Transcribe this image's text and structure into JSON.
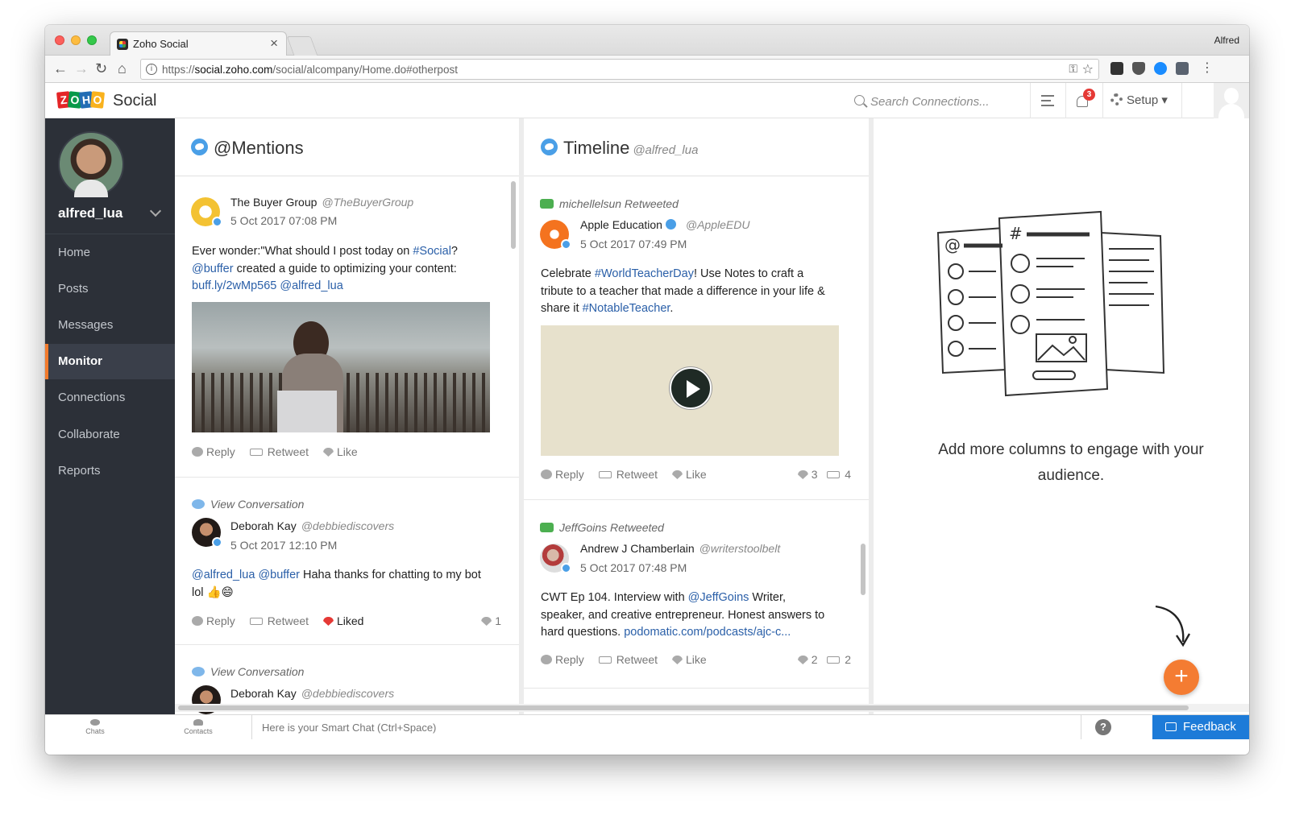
{
  "browser": {
    "tab_title": "Zoho Social",
    "profile": "Alfred",
    "url_scheme": "https://",
    "url_host": "social.zoho.com",
    "url_path": "/social/alcompany/Home.do#otherpost"
  },
  "header": {
    "logo_letters": [
      "Z",
      "O",
      "H",
      "O"
    ],
    "logo_text": "Social",
    "search_placeholder": "Search Connections...",
    "notification_count": "3",
    "setup_label": "Setup"
  },
  "sidebar": {
    "username": "alfred_lua",
    "items": [
      {
        "label": "Home",
        "active": false
      },
      {
        "label": "Posts",
        "active": false
      },
      {
        "label": "Messages",
        "active": false
      },
      {
        "label": "Monitor",
        "active": true
      },
      {
        "label": "Connections",
        "active": false
      },
      {
        "label": "Collaborate",
        "active": false
      },
      {
        "label": "Reports",
        "active": false
      }
    ]
  },
  "mentions": {
    "title": "@Mentions",
    "posts": [
      {
        "author": "The Buyer Group",
        "handle": "@TheBuyerGroup",
        "time": "5 Oct 2017 07:08 PM",
        "text_parts": [
          "Ever wonder:\"What should I post today on ",
          "#Social",
          "?",
          "@buffer",
          " created a guide to optimizing your content:",
          "buff.ly/2wMp565",
          "@alfred_lua"
        ],
        "reply": "Reply",
        "retweet": "Retweet",
        "like": "Like"
      },
      {
        "meta": "View Conversation",
        "author": "Deborah Kay",
        "handle": "@debbiediscovers",
        "time": "5 Oct 2017 12:10 PM",
        "text_parts": [
          "@alfred_lua",
          "@buffer",
          " Haha thanks for chatting to my bot",
          "lol 👍😄"
        ],
        "reply": "Reply",
        "retweet": "Retweet",
        "like": "Liked",
        "likes": "1"
      },
      {
        "meta": "View Conversation",
        "author": "Deborah Kay",
        "handle": "@debbiediscovers"
      }
    ]
  },
  "timeline": {
    "title": "Timeline",
    "subtitle": "@alfred_lua",
    "posts": [
      {
        "meta": "michellelsun Retweeted",
        "author": "Apple Education",
        "handle": "@AppleEDU",
        "time": "5 Oct 2017 07:49 PM",
        "text_parts": [
          "Celebrate ",
          "#WorldTeacherDay",
          "! Use Notes to craft a",
          "tribute to a teacher that made a difference in your life &",
          "share it ",
          "#NotableTeacher",
          "."
        ],
        "reply": "Reply",
        "retweet": "Retweet",
        "like": "Like",
        "likes": "3",
        "retweets": "4"
      },
      {
        "meta": "JeffGoins Retweeted",
        "author": "Andrew J Chamberlain",
        "handle": "@writerstoolbelt",
        "time": "5 Oct 2017 07:48 PM",
        "text_parts": [
          "CWT Ep 104. Interview with ",
          "@JeffGoins",
          " Writer,",
          "speaker, and creative entrepreneur. Honest answers to",
          "hard questions. ",
          "podomatic.com/podcasts/ajc-c..."
        ],
        "reply": "Reply",
        "retweet": "Retweet",
        "like": "Like",
        "likes": "2",
        "retweets": "2"
      }
    ]
  },
  "right_panel": {
    "message": "Add more columns to engage with your audience."
  },
  "bottom": {
    "chats": "Chats",
    "contacts": "Contacts",
    "smart_chat_placeholder": "Here is your Smart Chat (Ctrl+Space)",
    "help": "?",
    "feedback": "Feedback"
  }
}
